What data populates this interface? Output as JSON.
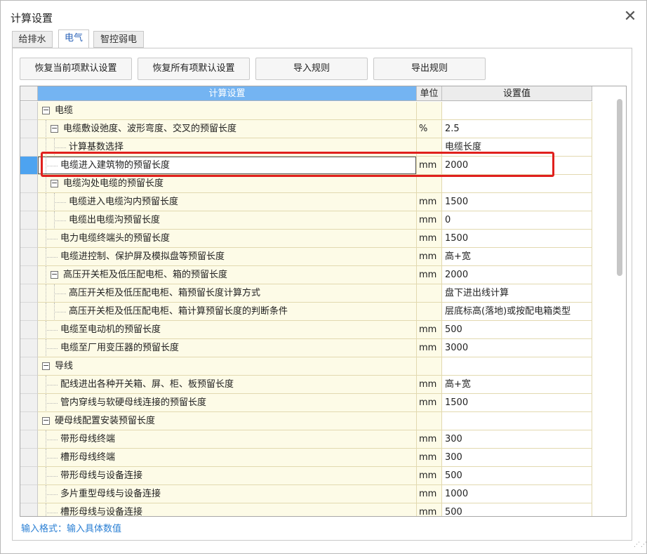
{
  "window": {
    "title": "计算设置"
  },
  "tabs": [
    {
      "label": "给排水",
      "active": false
    },
    {
      "label": "电气",
      "active": true
    },
    {
      "label": "智控弱电",
      "active": false
    }
  ],
  "toolbar": {
    "restore_current": "恢复当前项默认设置",
    "restore_all": "恢复所有项默认设置",
    "import_rules": "导入规则",
    "export_rules": "导出规则"
  },
  "grid": {
    "headers": {
      "name": "计算设置",
      "unit": "单位",
      "value": "设置值"
    },
    "rows": [
      {
        "name": "电缆",
        "unit": "",
        "value": "",
        "level": 0,
        "expander": true
      },
      {
        "name": "电缆敷设弛度、波形弯度、交叉的预留长度",
        "unit": "%",
        "value": "2.5",
        "level": 1,
        "expander": true
      },
      {
        "name": "计算基数选择",
        "unit": "",
        "value": "电缆长度",
        "level": 2,
        "expander": false
      },
      {
        "name": "电缆进入建筑物的预留长度",
        "unit": "mm",
        "value": "2000",
        "level": 1,
        "expander": false,
        "selected": true
      },
      {
        "name": "电缆沟处电缆的预留长度",
        "unit": "",
        "value": "",
        "level": 1,
        "expander": true
      },
      {
        "name": "电缆进入电缆沟内预留长度",
        "unit": "mm",
        "value": "1500",
        "level": 2,
        "expander": false
      },
      {
        "name": "电缆出电缆沟预留长度",
        "unit": "mm",
        "value": "0",
        "level": 2,
        "expander": false
      },
      {
        "name": "电力电缆终端头的预留长度",
        "unit": "mm",
        "value": "1500",
        "level": 1,
        "expander": false
      },
      {
        "name": "电缆进控制、保护屏及模拟盘等预留长度",
        "unit": "mm",
        "value": "高+宽",
        "level": 1,
        "expander": false
      },
      {
        "name": "高压开关柜及低压配电柜、箱的预留长度",
        "unit": "mm",
        "value": "2000",
        "level": 1,
        "expander": true
      },
      {
        "name": "高压开关柜及低压配电柜、箱预留长度计算方式",
        "unit": "",
        "value": "盘下进出线计算",
        "level": 2,
        "expander": false
      },
      {
        "name": "高压开关柜及低压配电柜、箱计算预留长度的判断条件",
        "unit": "",
        "value": "层底标高(落地)或按配电箱类型",
        "level": 2,
        "expander": false
      },
      {
        "name": "电缆至电动机的预留长度",
        "unit": "mm",
        "value": "500",
        "level": 1,
        "expander": false
      },
      {
        "name": "电缆至厂用变压器的预留长度",
        "unit": "mm",
        "value": "3000",
        "level": 1,
        "expander": false
      },
      {
        "name": "导线",
        "unit": "",
        "value": "",
        "level": 0,
        "expander": true
      },
      {
        "name": "配线进出各种开关箱、屏、柜、板预留长度",
        "unit": "mm",
        "value": "高+宽",
        "level": 1,
        "expander": false
      },
      {
        "name": "管内穿线与软硬母线连接的预留长度",
        "unit": "mm",
        "value": "1500",
        "level": 1,
        "expander": false
      },
      {
        "name": "硬母线配置安装预留长度",
        "unit": "",
        "value": "",
        "level": 0,
        "expander": true
      },
      {
        "name": "带形母线终端",
        "unit": "mm",
        "value": "300",
        "level": 1,
        "expander": false
      },
      {
        "name": "槽形母线终端",
        "unit": "mm",
        "value": "300",
        "level": 1,
        "expander": false
      },
      {
        "name": "带形母线与设备连接",
        "unit": "mm",
        "value": "500",
        "level": 1,
        "expander": false
      },
      {
        "name": "多片重型母线与设备连接",
        "unit": "mm",
        "value": "1000",
        "level": 1,
        "expander": false
      },
      {
        "name": "槽形母线与设备连接",
        "unit": "mm",
        "value": "500",
        "level": 1,
        "expander": false
      }
    ]
  },
  "hint": "输入格式：输入具体数值",
  "colors": {
    "accent": "#2b63b8",
    "header_bg": "#74b4f2",
    "highlight": "#e0201d",
    "hint": "#2a7fd4"
  }
}
